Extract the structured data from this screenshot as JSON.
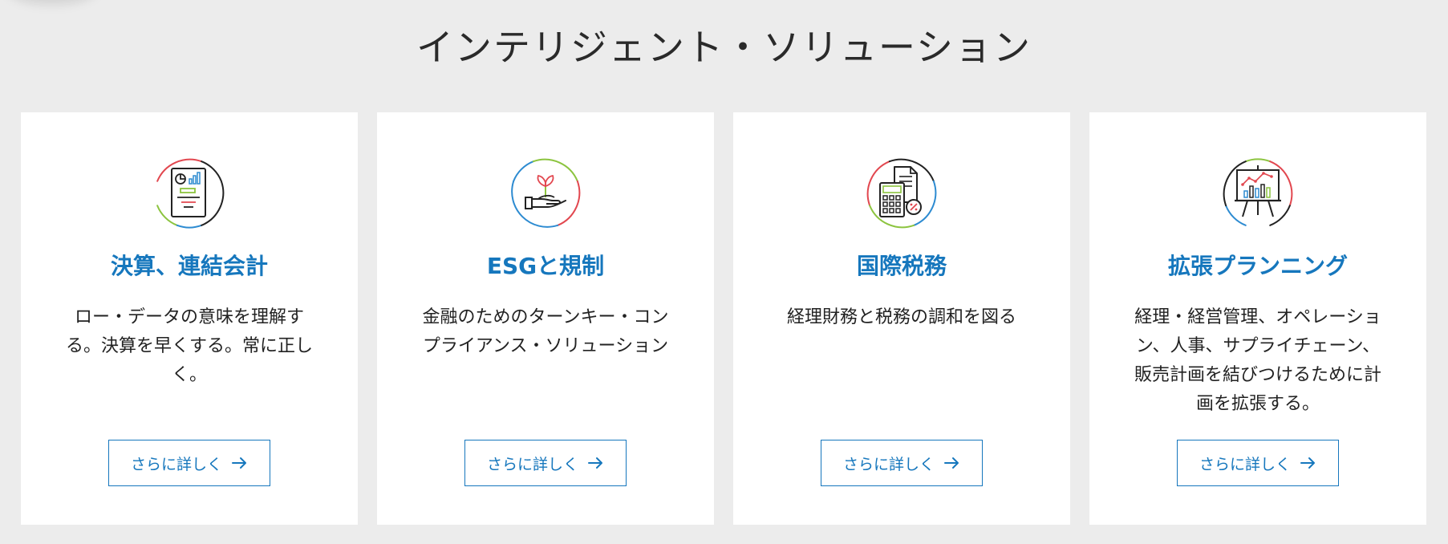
{
  "section": {
    "title": "インテリジェント・ソリューション"
  },
  "cards": [
    {
      "title": "決算、連結会計",
      "description": "ロー・データの意味を理解する。決算を早くする。常に正しく。",
      "cta": "さらに詳しく",
      "icon": "report-chart-icon"
    },
    {
      "title": "ESGと規制",
      "description": "金融のためのターンキー・コンプライアンス・ソリューション",
      "cta": "さらに詳しく",
      "icon": "sprout-hand-icon"
    },
    {
      "title": "国際税務",
      "description": "経理財務と税務の調和を図る",
      "cta": "さらに詳しく",
      "icon": "calculator-document-icon"
    },
    {
      "title": "拡張プランニング",
      "description": "経理・経営管理、オペレーション、人事、サプライチェーン、販売計画を結びつけるために計画を拡張する。",
      "cta": "さらに詳しく",
      "icon": "presentation-board-icon"
    }
  ],
  "colors": {
    "accent_blue": "#1677bd",
    "ring_red": "#e2474f",
    "ring_green": "#8cc43f",
    "ring_blue": "#2d8bd1",
    "ring_dark": "#222222",
    "background": "#ececec"
  }
}
